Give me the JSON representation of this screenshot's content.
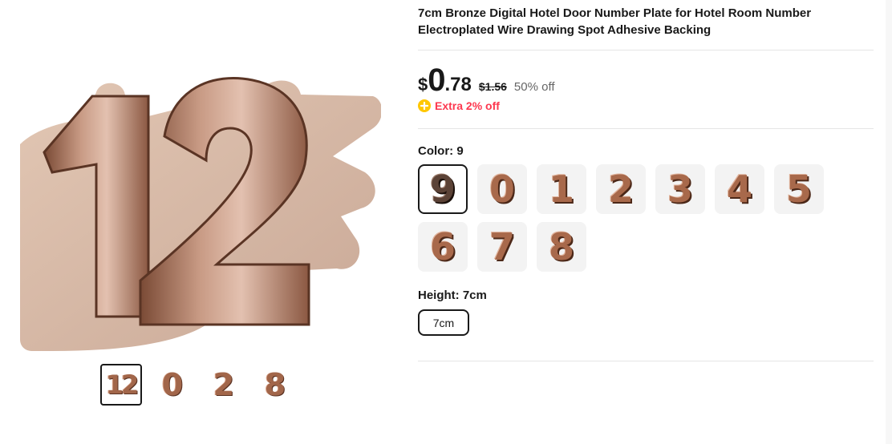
{
  "product": {
    "title": "7cm Bronze Digital Hotel Door Number Plate for Hotel Room Number Electroplated Wire Drawing Spot Adhesive Backing"
  },
  "gallery": {
    "main_image_icon": "bronze-number-12-on-hand-photo",
    "thumbnails": [
      {
        "label": "12",
        "active": true
      },
      {
        "label": "0",
        "active": false
      },
      {
        "label": "2",
        "active": false
      },
      {
        "label": "8",
        "active": false
      }
    ]
  },
  "price": {
    "currency": "$",
    "integer": "0",
    "decimal": ".78",
    "original": "$1.56",
    "discount": "50% off",
    "extra_offer": "Extra 2% off",
    "extra_icon": "coin-plus-icon"
  },
  "color": {
    "label": "Color: 9",
    "options": [
      "9",
      "0",
      "1",
      "2",
      "3",
      "4",
      "5",
      "6",
      "7",
      "8"
    ],
    "selected": "9"
  },
  "height": {
    "label": "Height: 7cm",
    "options": [
      "7cm"
    ],
    "selected": "7cm"
  },
  "colors": {
    "text": "#191919",
    "sale_red": "#fd384f",
    "coin_yellow": "#ffc700",
    "muted": "#666666",
    "bronze": "#a8694b"
  }
}
